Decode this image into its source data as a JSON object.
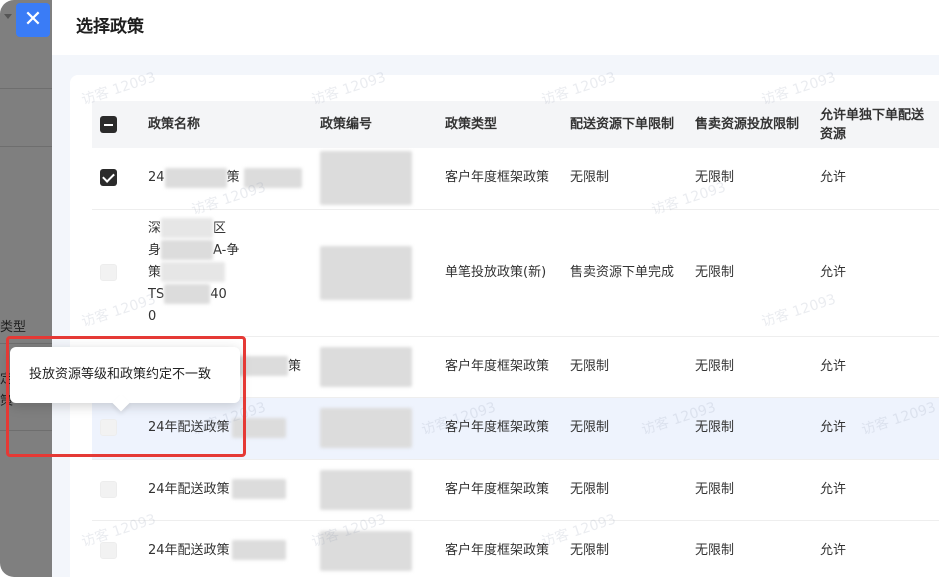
{
  "close_icon": "✕",
  "backdrop": {
    "label_type": "类型",
    "label_2": "定",
    "label_3": "策"
  },
  "panel": {
    "title": "选择政策"
  },
  "table": {
    "headers": {
      "name": "政策名称",
      "code": "政策编号",
      "type": "政策类型",
      "delivery_limit": "配送资源下单限制",
      "sale_limit": "售卖资源投放限制",
      "allow_single": "允许单独下单配送资源"
    },
    "rows": [
      {
        "checkbox": "checked",
        "name": "24",
        "name_tail": "策",
        "type": "客户年度框架政策",
        "delivery_limit": "无限制",
        "sale_limit": "无限制",
        "allow_single": "允许"
      },
      {
        "checkbox": "disabled",
        "name_lines": [
          "深",
          "身",
          "策",
          "TS",
          "0"
        ],
        "name_tails": [
          "区",
          "A-争",
          "",
          "40",
          ""
        ],
        "type": "单笔投放政策(新)",
        "delivery_limit": "售卖资源下单完成",
        "sale_limit": "无限制",
        "allow_single": "允许"
      },
      {
        "checkbox": "disabled",
        "name": "",
        "name_tail": "策",
        "type": "客户年度框架政策",
        "delivery_limit": "无限制",
        "sale_limit": "无限制",
        "allow_single": "允许"
      },
      {
        "checkbox": "disabled",
        "name": "24年配送政",
        "name_tail": "策",
        "type": "客户年度框架政策",
        "delivery_limit": "无限制",
        "sale_limit": "无限制",
        "allow_single": "允许"
      },
      {
        "checkbox": "disabled",
        "name": "24年配送政",
        "name_tail": "策",
        "type": "客户年度框架政策",
        "delivery_limit": "无限制",
        "sale_limit": "无限制",
        "allow_single": "允许"
      },
      {
        "checkbox": "disabled",
        "name": "24年配送政",
        "name_tail": "策",
        "type": "客户年度框架政策",
        "delivery_limit": "无限制",
        "sale_limit": "无限制",
        "allow_single": "允许"
      }
    ]
  },
  "tooltip": {
    "text": "投放资源等级和政策约定不一致"
  },
  "watermark": "访客 12093",
  "colors": {
    "accent": "#3a7cf6",
    "highlight_row": "#eef3fd",
    "annotation_red": "#e53935"
  }
}
